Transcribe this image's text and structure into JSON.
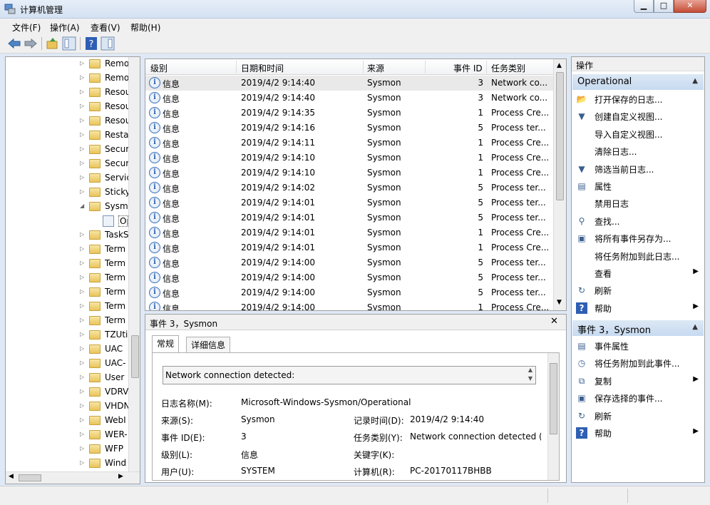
{
  "window": {
    "title": "计算机管理",
    "min": "▁",
    "max": "□",
    "close": "✕"
  },
  "menu": [
    "文件(F)",
    "操作(A)",
    "查看(V)",
    "帮助(H)"
  ],
  "tree": {
    "items": [
      {
        "label": "Remo",
        "arrow": "▷"
      },
      {
        "label": "Remo",
        "arrow": "▷"
      },
      {
        "label": "Resou",
        "arrow": "▷"
      },
      {
        "label": "Resou",
        "arrow": "▷"
      },
      {
        "label": "Resou",
        "arrow": "▷"
      },
      {
        "label": "Resta",
        "arrow": "▷"
      },
      {
        "label": "Secur",
        "arrow": "▷"
      },
      {
        "label": "Secur",
        "arrow": "▷"
      },
      {
        "label": "Servic",
        "arrow": "▷"
      },
      {
        "label": "Sticky",
        "arrow": "▷"
      },
      {
        "label": "Sysm",
        "arrow": "◢"
      },
      {
        "label": "Op",
        "arrow": ""
      },
      {
        "label": "TaskS",
        "arrow": "▷"
      },
      {
        "label": "Term",
        "arrow": "▷"
      },
      {
        "label": "Term",
        "arrow": "▷"
      },
      {
        "label": "Term",
        "arrow": "▷"
      },
      {
        "label": "Term",
        "arrow": "▷"
      },
      {
        "label": "Term",
        "arrow": "▷"
      },
      {
        "label": "Term",
        "arrow": "▷"
      },
      {
        "label": "TZUti",
        "arrow": "▷"
      },
      {
        "label": "UAC",
        "arrow": "▷"
      },
      {
        "label": "UAC-",
        "arrow": "▷"
      },
      {
        "label": "User",
        "arrow": "▷"
      },
      {
        "label": "VDRV",
        "arrow": "▷"
      },
      {
        "label": "VHDN",
        "arrow": "▷"
      },
      {
        "label": "WebI",
        "arrow": "▷"
      },
      {
        "label": "WER-",
        "arrow": "▷"
      },
      {
        "label": "WFP",
        "arrow": "▷"
      },
      {
        "label": "Wind",
        "arrow": "▷"
      }
    ]
  },
  "events": {
    "columns": [
      "级别",
      "日期和时间",
      "来源",
      "事件 ID",
      "任务类别"
    ],
    "rows": [
      {
        "level": "信息",
        "datetime": "2019/4/2 9:14:40",
        "source": "Sysmon",
        "id": "3",
        "category": "Network co..."
      },
      {
        "level": "信息",
        "datetime": "2019/4/2 9:14:40",
        "source": "Sysmon",
        "id": "3",
        "category": "Network co..."
      },
      {
        "level": "信息",
        "datetime": "2019/4/2 9:14:35",
        "source": "Sysmon",
        "id": "1",
        "category": "Process Cre..."
      },
      {
        "level": "信息",
        "datetime": "2019/4/2 9:14:16",
        "source": "Sysmon",
        "id": "5",
        "category": "Process ter..."
      },
      {
        "level": "信息",
        "datetime": "2019/4/2 9:14:11",
        "source": "Sysmon",
        "id": "1",
        "category": "Process Cre..."
      },
      {
        "level": "信息",
        "datetime": "2019/4/2 9:14:10",
        "source": "Sysmon",
        "id": "1",
        "category": "Process Cre..."
      },
      {
        "level": "信息",
        "datetime": "2019/4/2 9:14:10",
        "source": "Sysmon",
        "id": "1",
        "category": "Process Cre..."
      },
      {
        "level": "信息",
        "datetime": "2019/4/2 9:14:02",
        "source": "Sysmon",
        "id": "5",
        "category": "Process ter..."
      },
      {
        "level": "信息",
        "datetime": "2019/4/2 9:14:01",
        "source": "Sysmon",
        "id": "5",
        "category": "Process ter..."
      },
      {
        "level": "信息",
        "datetime": "2019/4/2 9:14:01",
        "source": "Sysmon",
        "id": "5",
        "category": "Process ter..."
      },
      {
        "level": "信息",
        "datetime": "2019/4/2 9:14:01",
        "source": "Sysmon",
        "id": "1",
        "category": "Process Cre..."
      },
      {
        "level": "信息",
        "datetime": "2019/4/2 9:14:01",
        "source": "Sysmon",
        "id": "1",
        "category": "Process Cre..."
      },
      {
        "level": "信息",
        "datetime": "2019/4/2 9:14:00",
        "source": "Sysmon",
        "id": "5",
        "category": "Process ter..."
      },
      {
        "level": "信息",
        "datetime": "2019/4/2 9:14:00",
        "source": "Sysmon",
        "id": "5",
        "category": "Process ter..."
      },
      {
        "level": "信息",
        "datetime": "2019/4/2 9:14:00",
        "source": "Sysmon",
        "id": "5",
        "category": "Process ter..."
      },
      {
        "level": "信息",
        "datetime": "2019/4/2 9:14:00",
        "source": "Sysmon",
        "id": "1",
        "category": "Process Cre..."
      }
    ]
  },
  "detail": {
    "title": "事件 3，Sysmon",
    "close": "✕",
    "tabs": [
      "常规",
      "详细信息"
    ],
    "message": "Network connection detected:",
    "labels": {
      "log_name": "日志名称(M):",
      "source": "来源(S):",
      "logged": "记录时间(D):",
      "event_id": "事件 ID(E):",
      "task": "任务类别(Y):",
      "level": "级别(L):",
      "keywords": "关键字(K):",
      "user": "用户(U):",
      "computer": "计算机(R):"
    },
    "values": {
      "log_name": "Microsoft-Windows-Sysmon/Operational",
      "source": "Sysmon",
      "logged": "2019/4/2 9:14:40",
      "event_id": "3",
      "task": "Network connection detected (",
      "level": "信息",
      "keywords": "",
      "user": "SYSTEM",
      "computer": "PC-20170117BHBB"
    }
  },
  "actions": {
    "header": "操作",
    "section1": "Operational",
    "items1": [
      {
        "label": "打开保存的日志...",
        "icon": "open-folder-icon",
        "glyph": "📂",
        "arrow": ""
      },
      {
        "label": "创建自定义视图...",
        "icon": "filter-star-icon",
        "glyph": "▼",
        "arrow": ""
      },
      {
        "label": "导入自定义视图...",
        "icon": "",
        "glyph": "",
        "arrow": ""
      },
      {
        "label": "清除日志...",
        "icon": "",
        "glyph": "",
        "arrow": ""
      },
      {
        "label": "筛选当前日志...",
        "icon": "filter-icon",
        "glyph": "▼",
        "arrow": ""
      },
      {
        "label": "属性",
        "icon": "properties-icon",
        "glyph": "▤",
        "arrow": ""
      },
      {
        "label": "禁用日志",
        "icon": "",
        "glyph": "",
        "arrow": ""
      },
      {
        "label": "查找...",
        "icon": "find-icon",
        "glyph": "⚲",
        "arrow": ""
      },
      {
        "label": "将所有事件另存为...",
        "icon": "save-icon",
        "glyph": "▣",
        "arrow": ""
      },
      {
        "label": "将任务附加到此日志...",
        "icon": "",
        "glyph": "",
        "arrow": ""
      },
      {
        "label": "查看",
        "icon": "",
        "glyph": "",
        "arrow": "▶"
      },
      {
        "label": "刷新",
        "icon": "refresh-icon",
        "glyph": "↻",
        "arrow": ""
      },
      {
        "label": "帮助",
        "icon": "help-icon",
        "glyph": "?",
        "arrow": "▶"
      }
    ],
    "section2": "事件 3，Sysmon",
    "items2": [
      {
        "label": "事件属性",
        "icon": "properties-icon",
        "glyph": "▤",
        "arrow": ""
      },
      {
        "label": "将任务附加到此事件...",
        "icon": "task-icon",
        "glyph": "◷",
        "arrow": ""
      },
      {
        "label": "复制",
        "icon": "copy-icon",
        "glyph": "⧉",
        "arrow": "▶"
      },
      {
        "label": "保存选择的事件...",
        "icon": "save-icon",
        "glyph": "▣",
        "arrow": ""
      },
      {
        "label": "刷新",
        "icon": "refresh-icon",
        "glyph": "↻",
        "arrow": ""
      },
      {
        "label": "帮助",
        "icon": "help-icon",
        "glyph": "?",
        "arrow": "▶"
      }
    ]
  },
  "icons": {
    "info_glyph": "i",
    "collapse_glyph": "▲"
  },
  "colors": {
    "selection": "#e9e9e9",
    "section_bg": "#c7daf0",
    "help_blue": "#2e5fb4"
  }
}
